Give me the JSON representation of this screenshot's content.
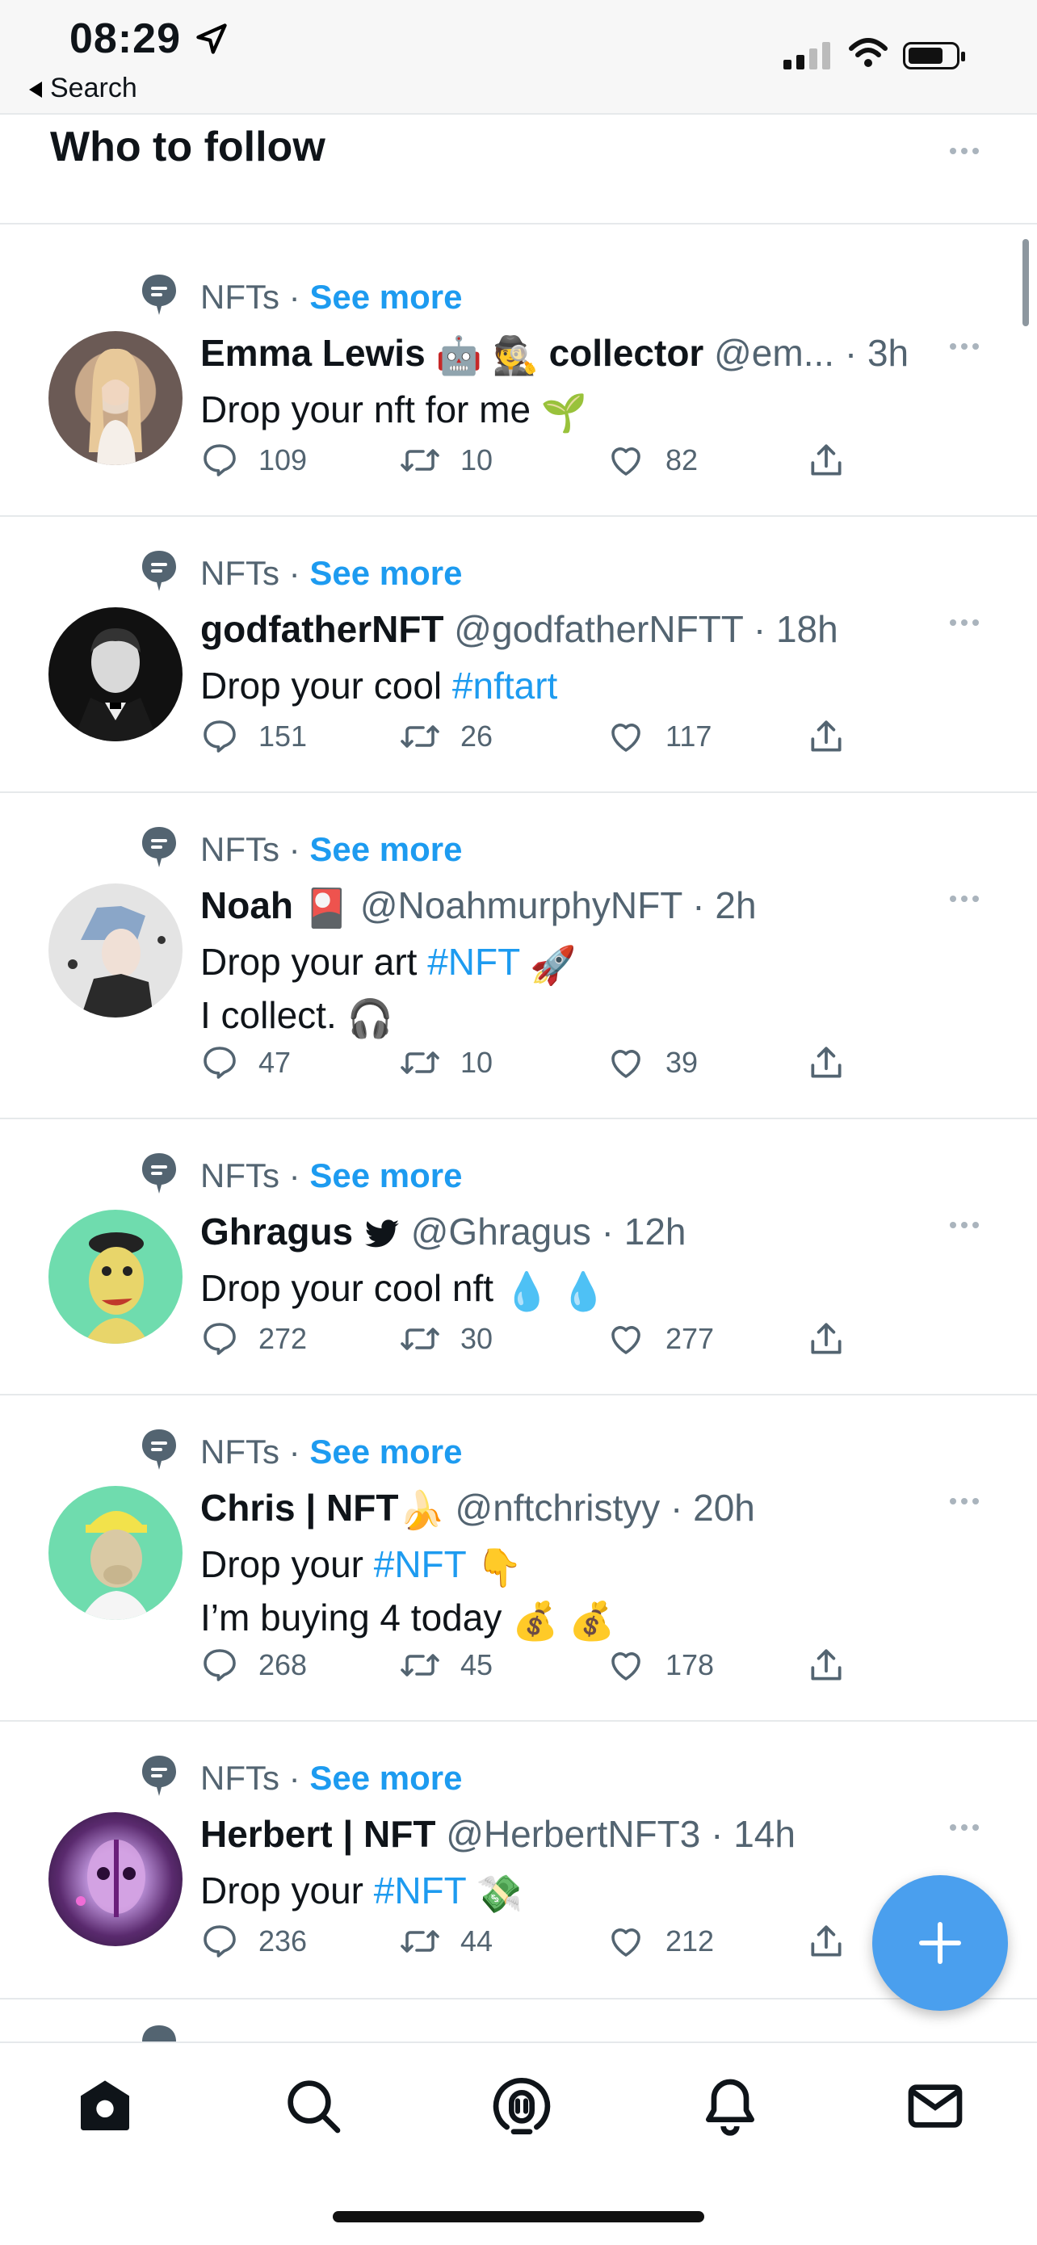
{
  "status_bar": {
    "time": "08:29",
    "back_label": "Search"
  },
  "section": {
    "title": "Who to follow"
  },
  "topic_label": "NFTs",
  "topic_sep": "·",
  "see_more": "See more",
  "tweets": [
    {
      "name": "Emma Lewis",
      "name_suffix": "collector",
      "handle": "@em...",
      "time": "· 3h",
      "text1": "Drop your nft for me",
      "text2": "",
      "replies": "109",
      "retweets": "10",
      "likes": "82"
    },
    {
      "name": "godfatherNFT",
      "name_suffix": "",
      "handle": "@godfatherNFTT",
      "time": "· 18h",
      "text1": "Drop your cool",
      "tag1": "#nftart",
      "text2": "",
      "replies": "151",
      "retweets": "26",
      "likes": "117"
    },
    {
      "name": "Noah",
      "name_suffix": "",
      "handle": "@NoahmurphyNFT",
      "time": "· 2h",
      "text1": "Drop your art",
      "tag1": "#NFT",
      "text2": "I collect.",
      "replies": "47",
      "retweets": "10",
      "likes": "39"
    },
    {
      "name": "Ghragus",
      "name_suffix": "",
      "handle": "@Ghragus",
      "time": "· 12h",
      "text1": "Drop your cool nft",
      "text2": "",
      "replies": "272",
      "retweets": "30",
      "likes": "277"
    },
    {
      "name": "Chris | NFT",
      "name_suffix": "",
      "handle": "@nftchristyy",
      "time": "· 20h",
      "text1": "Drop your",
      "tag1": "#NFT",
      "text2": "I’m buying 4 today",
      "replies": "268",
      "retweets": "45",
      "likes": "178"
    },
    {
      "name": "Herbert | NFT",
      "name_suffix": "",
      "handle": "@HerbertNFT3",
      "time": "· 14h",
      "text1": "Drop your",
      "tag1": "#NFT",
      "text2": "",
      "replies": "236",
      "retweets": "44",
      "likes": "212"
    }
  ],
  "colors": {
    "accent": "#1d9bf0",
    "fab": "#4a9fee",
    "muted": "#536471"
  }
}
